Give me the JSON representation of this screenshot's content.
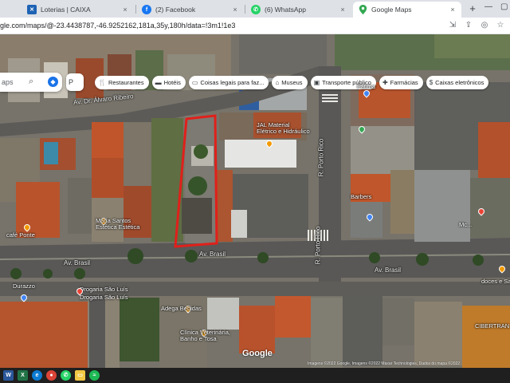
{
  "browser": {
    "tabs": [
      {
        "label": "Loterias | CAIXA",
        "icon": "loterias-favicon"
      },
      {
        "label": "(2) Facebook",
        "icon": "facebook-favicon"
      },
      {
        "label": "(6) WhatsApp",
        "icon": "whatsapp-favicon"
      },
      {
        "label": "Google Maps",
        "icon": "google-maps-favicon",
        "active": true
      }
    ],
    "new_tab": "+",
    "close_glyph": "×",
    "url": "gle.com/maps/@-23.4438787,-46.9252162,181a,35y,180h/data=!3m1!1e3"
  },
  "maps": {
    "search_value": "aps",
    "side_button_label": "P",
    "chips": [
      {
        "label": "Restaurantes",
        "icon": "fork-knife-icon"
      },
      {
        "label": "Hotéis",
        "icon": "bed-icon"
      },
      {
        "label": "Coisas legais para faz...",
        "icon": "ticket-icon"
      },
      {
        "label": "Museus",
        "icon": "museum-icon"
      },
      {
        "label": "Transporte público",
        "icon": "bus-icon"
      },
      {
        "label": "Farmácias",
        "icon": "pharmacy-icon"
      },
      {
        "label": "Caixas eletrônicos",
        "icon": "atm-icon"
      }
    ],
    "labels": {
      "av_alvaro": "Av. Dr. Álvaro Ribeiro",
      "av_brasil_1": "Av. Brasil",
      "av_brasil_2": "Av. Brasil",
      "av_brasil_3": "Av. Brasil",
      "r_porto_rico_1": "R. Porto Rico",
      "r_porto_rico_2": "R. Porto Rico",
      "jal": "JAL Material\nElétrico e Hidráulico",
      "fatima": "Fátima",
      "barbers": "Barbers",
      "maria_santos": "Maria Santos\nEstética Estética",
      "cafe": "café Ponte",
      "durazzo": "Durazzo",
      "drogasil_1": "Drogaria São Luís",
      "drogasil_2": "Drogaria São Luís",
      "adega": "Adega Bebidas",
      "clinica": "Clínica Veterinária,\nBanho e Tosa",
      "cibertran": "CIBERTRAN",
      "doces": "doces e Salgados",
      "mc": "Mc..."
    },
    "google_logo": "Google",
    "attribution": "Imagens ©2022 Google, Imagens ©2022 Maxar Technologies, Dados do mapa ©2022"
  },
  "colors": {
    "highlight_outline": "#e0201b",
    "road": "#5d5d5d",
    "chrome_bg": "#dee1e6"
  },
  "taskbar": {
    "items": [
      "word-icon",
      "excel-icon",
      "edge-icon",
      "chrome-icon",
      "whatsapp-icon",
      "explorer-icon",
      "spotify-icon"
    ]
  }
}
